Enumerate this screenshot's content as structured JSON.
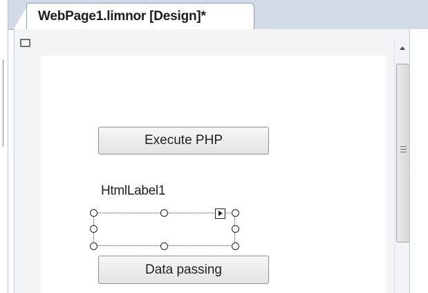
{
  "tab": {
    "label": "WebPage1.limnor [Design]*"
  },
  "designer": {
    "execute_button": "Execute PHP",
    "label": "HtmlLabel1",
    "data_button": "Data passing"
  },
  "colors": {
    "tab_strip": "#d3dbe8",
    "surface": "#f3f4f6",
    "page": "#ffffff"
  }
}
